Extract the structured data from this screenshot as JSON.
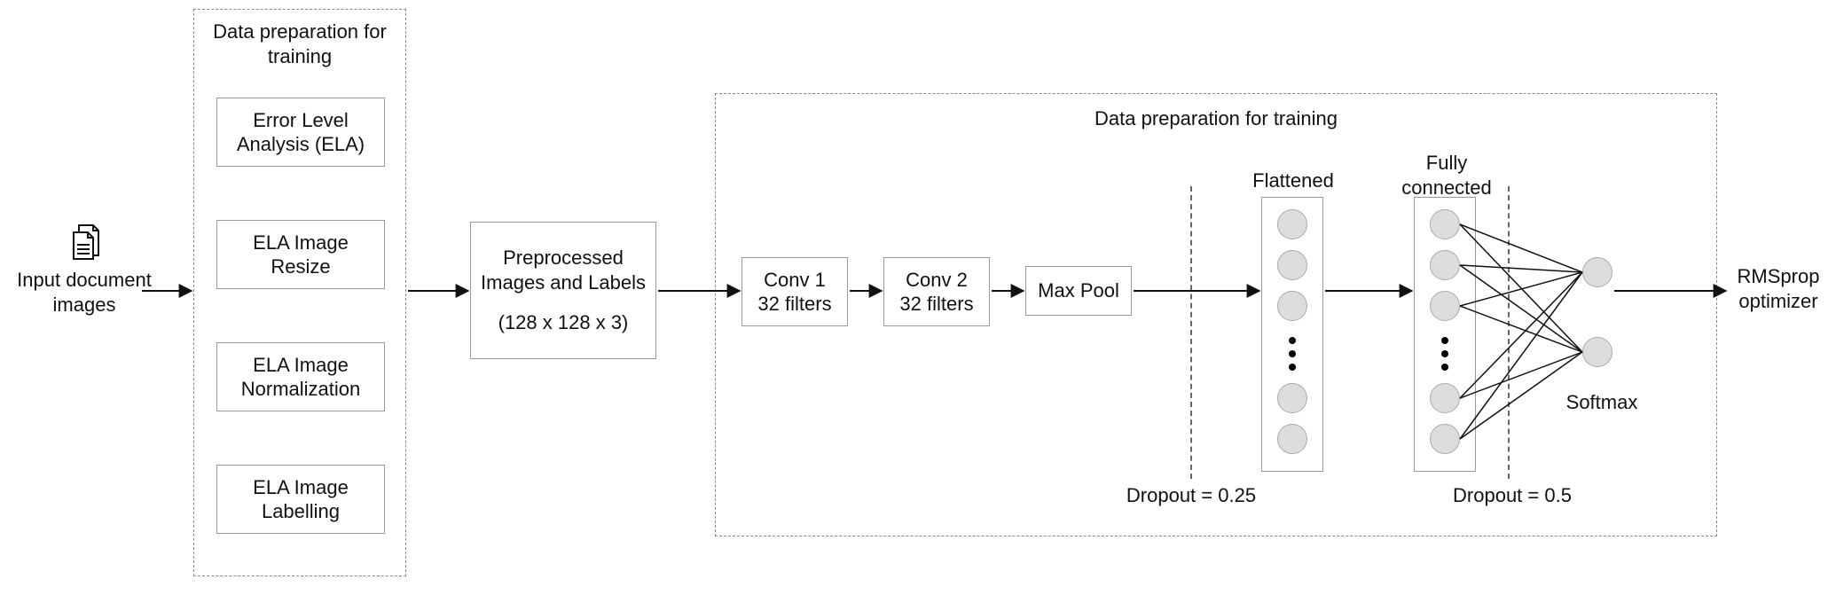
{
  "input_label": "Input document\nimages",
  "prep_group_title": "Data preparation for\ntraining",
  "prep_steps": [
    "Error Level\nAnalysis (ELA)",
    "ELA Image\nResize",
    "ELA Image\nNormalization",
    "ELA Image\nLabelling"
  ],
  "preprocessed": {
    "title": "Preprocessed\nImages and Labels",
    "shape": "(128 x 128 x 3)"
  },
  "model_group_title": "Data preparation for training",
  "layers": {
    "conv1": "Conv 1\n32 filters",
    "conv2": "Conv 2\n32 filters",
    "maxpool": "Max Pool"
  },
  "flattened_label": "Flattened",
  "fc_label": "Fully\nconnected",
  "softmax_label": "Softmax",
  "dropout1": "Dropout = 0.25",
  "dropout2": "Dropout = 0.5",
  "optimizer": "RMSprop\noptimizer",
  "chart_data": {
    "type": "table",
    "flow": [
      "Input document images",
      "Error Level Analysis (ELA)",
      "ELA Image Resize",
      "ELA Image Normalization",
      "ELA Image Labelling",
      "Preprocessed Images and Labels (128 x 128 x 3)",
      "Conv 1 (32 filters)",
      "Conv 2 (32 filters)",
      "Max Pool",
      "Dropout = 0.25",
      "Flattened",
      "Fully connected",
      "Dropout = 0.5",
      "Softmax",
      "RMSprop optimizer"
    ]
  }
}
